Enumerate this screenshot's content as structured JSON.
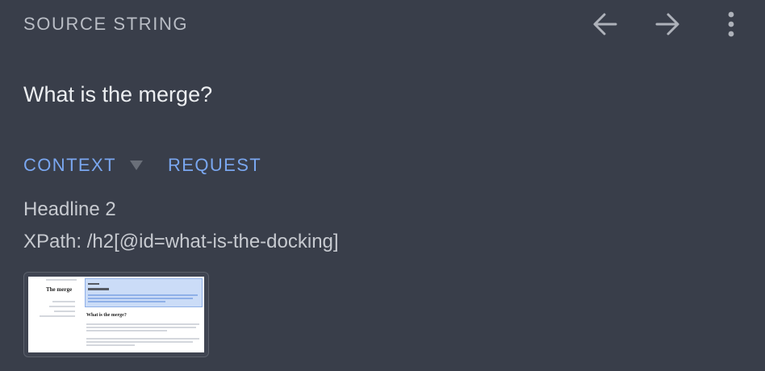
{
  "header": {
    "title": "SOURCE STRING",
    "back_icon": "arrow-left-icon",
    "forward_icon": "arrow-right-icon",
    "more_icon": "more-vertical-icon"
  },
  "source": {
    "text": "What is the merge?"
  },
  "tabs": [
    {
      "label": "CONTEXT",
      "has_dropdown": true
    },
    {
      "label": "REQUEST"
    }
  ],
  "context": {
    "element_type": "Headline 2",
    "xpath": "XPath: /h2[@id=what-is-the-docking]"
  },
  "screenshot_thumbnail": {
    "icon": "page-screenshot-thumbnail",
    "page_title": "The merge",
    "heading": "What is the merge?"
  },
  "colors": {
    "background": "#393e4a",
    "accent": "#7aa7f0",
    "title_text": "#b9bdc5",
    "body_text": "#c7cad0"
  }
}
